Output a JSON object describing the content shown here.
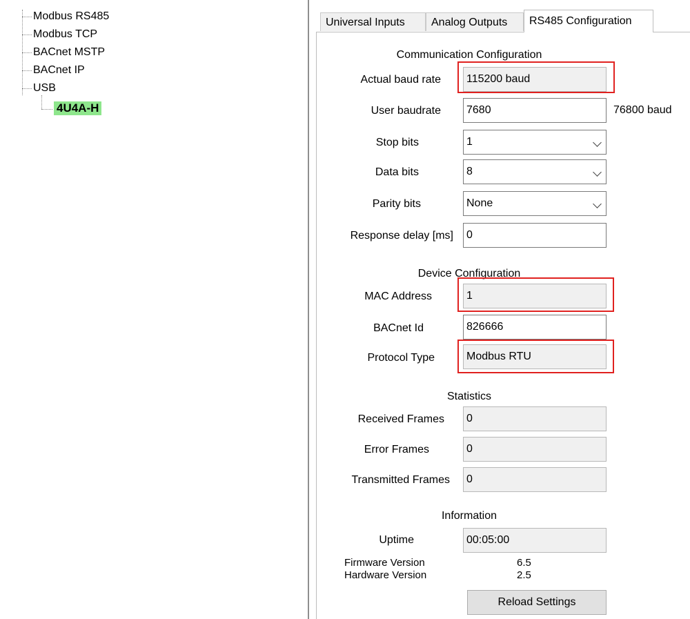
{
  "tree": {
    "items": [
      "Modbus RS485",
      "Modbus TCP",
      "BACnet MSTP",
      "BACnet IP",
      "USB"
    ],
    "child": "4U4A-H"
  },
  "tabs": [
    "Universal Inputs",
    "Analog Outputs",
    "RS485 Configuration"
  ],
  "active_tab": "RS485 Configuration",
  "comm": {
    "title": "Communication Configuration",
    "actual_baud_label": "Actual baud rate",
    "actual_baud_value": "115200 baud",
    "user_baud_label": "User baudrate",
    "user_baud_value": "7680",
    "user_baud_note": "76800 baud",
    "stop_bits_label": "Stop bits",
    "stop_bits_value": "1",
    "data_bits_label": "Data bits",
    "data_bits_value": "8",
    "parity_label": "Parity bits",
    "parity_value": "None",
    "delay_label": "Response delay [ms]",
    "delay_value": "0"
  },
  "device": {
    "title": "Device Configuration",
    "mac_label": "MAC Address",
    "mac_value": "1",
    "bacnet_label": "BACnet Id",
    "bacnet_value": "826666",
    "protocol_label": "Protocol Type",
    "protocol_value": "Modbus RTU"
  },
  "stats": {
    "title": "Statistics",
    "received_label": "Received Frames",
    "received_value": "0",
    "error_label": "Error Frames",
    "error_value": "0",
    "transmitted_label": "Transmitted Frames",
    "transmitted_value": "0"
  },
  "info": {
    "title": "Information",
    "uptime_label": "Uptime",
    "uptime_value": "00:05:00",
    "firmware_label": "Firmware Version",
    "firmware_value": "6.5",
    "hardware_label": "Hardware Version",
    "hardware_value": "2.5",
    "reload_button": "Reload Settings"
  },
  "colors": {
    "highlight": "#e0211f",
    "selected_node": "#8ee68c"
  }
}
